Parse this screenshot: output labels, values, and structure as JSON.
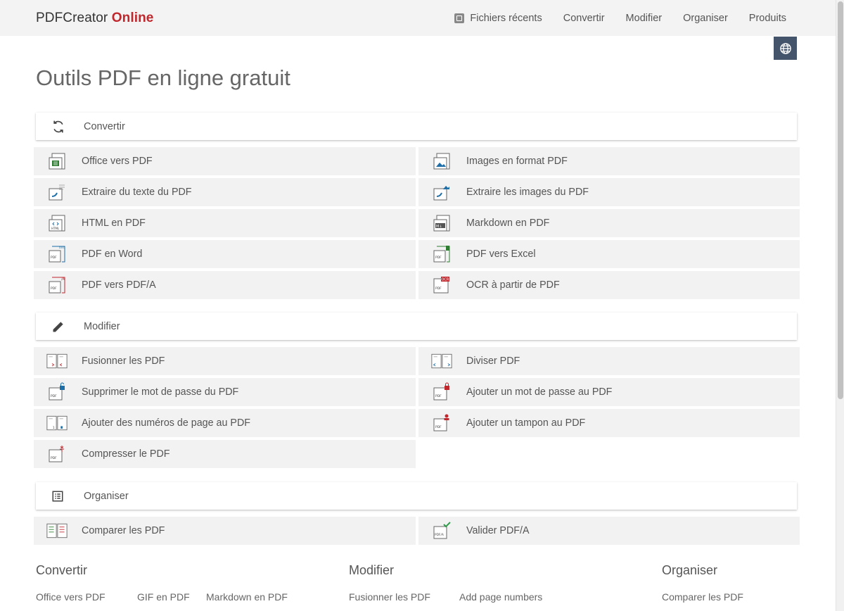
{
  "header": {
    "logo_main": "PDFCreator",
    "logo_accent": "Online",
    "nav": [
      "Fichiers récents",
      "Convertir",
      "Modifier",
      "Organiser",
      "Produits"
    ]
  },
  "page_title": "Outils PDF en ligne gratuit",
  "sections": {
    "convertir": {
      "title": "Convertir",
      "tools": [
        "Office vers PDF",
        "Images en format PDF",
        "Extraire du texte du PDF",
        "Extraire les images du PDF",
        "HTML en PDF",
        "Markdown en PDF",
        "PDF en Word",
        "PDF vers Excel",
        "PDF vers PDF/A",
        "OCR à partir de PDF"
      ]
    },
    "modifier": {
      "title": "Modifier",
      "tools": [
        "Fusionner les PDF",
        "Diviser PDF",
        "Supprimer le mot de passe du PDF",
        "Ajouter un mot de passe au PDF",
        "Ajouter des numéros de page au PDF",
        "Ajouter un tampon au PDF",
        "Compresser le PDF"
      ]
    },
    "organiser": {
      "title": "Organiser",
      "tools": [
        "Comparer les PDF",
        "Valider PDF/A"
      ]
    }
  },
  "footer": {
    "columns": [
      {
        "title": "Convertir",
        "links": [
          "Office vers PDF",
          "GIF en PDF",
          "Markdown en PDF"
        ]
      },
      {
        "title": "Modifier",
        "links": [
          "Fusionner les PDF",
          "Add page numbers"
        ]
      },
      {
        "title": "Organiser",
        "links": [
          "Comparer les PDF"
        ]
      }
    ]
  },
  "colors": {
    "brand_accent": "#c0272d",
    "language_button": "#44546a",
    "header_bg": "#f3f3f3",
    "tool_bg": "#f2f2f2"
  },
  "icons": {
    "language": "globe-icon",
    "convert_section": "refresh-icon",
    "modify_section": "pencil-icon",
    "organize_section": "list-icon"
  }
}
